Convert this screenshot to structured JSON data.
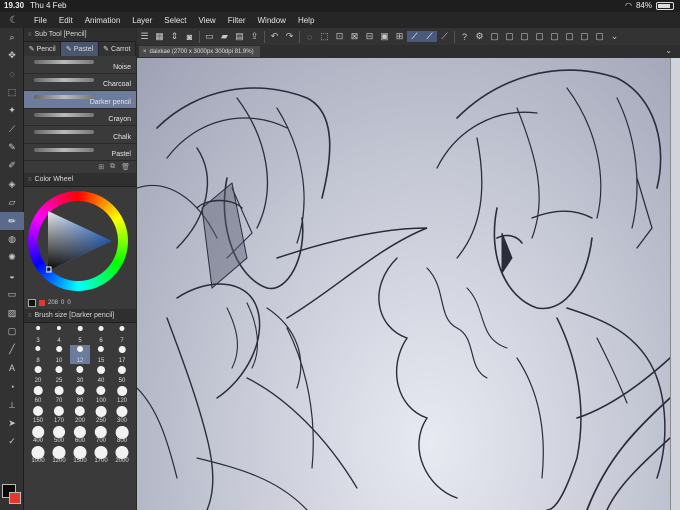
{
  "status": {
    "time": "19.30",
    "date": "Thu 4 Feb",
    "battery": "84%",
    "battery_level": 0.84
  },
  "menu": [
    "File",
    "Edit",
    "Animation",
    "Layer",
    "Select",
    "View",
    "Filter",
    "Window",
    "Help"
  ],
  "tools": [
    "zoom-icon",
    "move-icon",
    "lasso-icon",
    "select-icon",
    "wand-icon",
    "eyedropper-icon",
    "pen-icon",
    "brush-icon",
    "fill-icon",
    "eraser-icon",
    "pencil-icon",
    "airbrush-icon",
    "decorate-icon",
    "blend-icon",
    "figure-icon",
    "gradient-icon",
    "frame-icon",
    "line-icon",
    "text-icon",
    "balloon-icon",
    "ruler-icon",
    "operation-icon",
    "correct-icon"
  ],
  "subtool": {
    "title": "Sub Tool [Pencil]",
    "tabs": [
      "Pencil",
      "Pastel",
      "Carrot"
    ],
    "active_tab": 1,
    "brushes": [
      "Noise",
      "Charcoal",
      "Darker pencil",
      "Crayon",
      "Chalk",
      "Pastel"
    ],
    "active_brush": 2
  },
  "color_wheel": {
    "title": "Color Wheel",
    "h": "208",
    "s": "0",
    "v": "0"
  },
  "brush_size": {
    "title": "Brush size [Darker pencil]",
    "sizes": [
      "3",
      "4",
      "5",
      "6",
      "7",
      "8",
      "10",
      "12",
      "15",
      "17",
      "20",
      "25",
      "30",
      "40",
      "50",
      "60",
      "70",
      "80",
      "100",
      "120",
      "150",
      "170",
      "200",
      "250",
      "300",
      "400",
      "500",
      "600",
      "700",
      "800",
      "1000",
      "1200",
      "1500",
      "1700",
      "2000"
    ],
    "active": "12"
  },
  "document_tab": "daixkae (2700 x 3000px 300dpi 81.9%)",
  "colors": {
    "accent": "#6d7b9c",
    "main_color": "#0a0a0a",
    "sub_color": "#e03a2f"
  }
}
